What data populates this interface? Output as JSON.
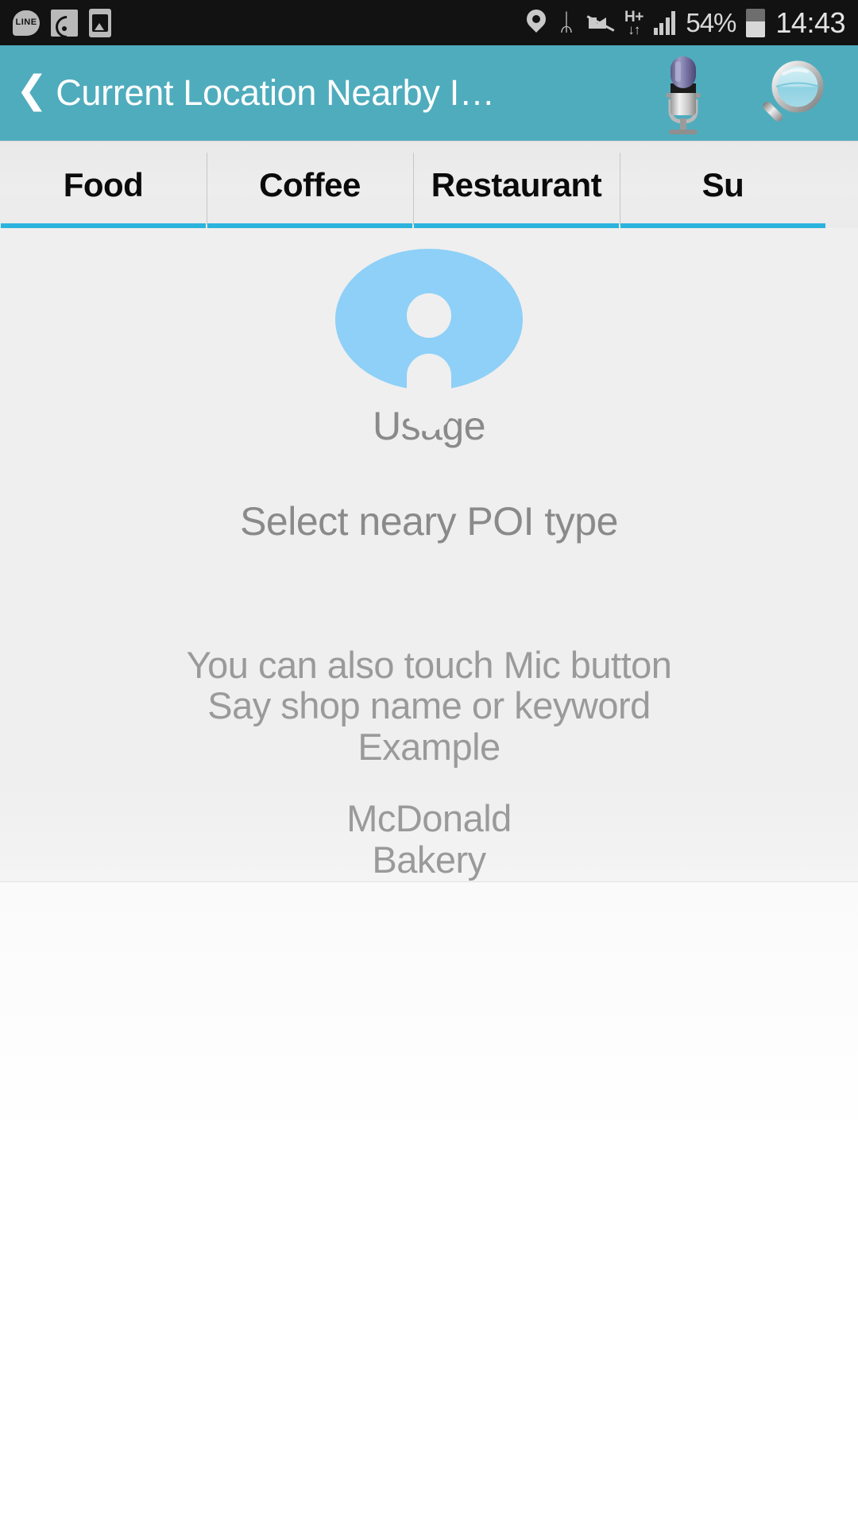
{
  "statusbar": {
    "left_icons": [
      {
        "name": "line-app-icon",
        "label": "LINE"
      },
      {
        "name": "wifi-icon",
        "label": ""
      },
      {
        "name": "gallery-icon",
        "label": ""
      }
    ],
    "right_icons": [
      {
        "name": "location-pin-icon",
        "label": ""
      },
      {
        "name": "bluetooth-icon",
        "label": "ᛦ"
      },
      {
        "name": "volume-mute-icon",
        "label": ""
      }
    ],
    "network_type": "H+",
    "network_arrows": "↓↑",
    "battery_percent": "54%",
    "battery_level": 54,
    "clock": "14:43"
  },
  "appbar": {
    "back_label": "❮",
    "title": "Current Location Nearby I…",
    "mic_icon": "microphone-icon",
    "search_icon": "magnifier-icon",
    "background_color": "#4FACBD"
  },
  "tabs": {
    "items": [
      {
        "label": "Food",
        "selected": true
      },
      {
        "label": "Coffee",
        "selected": true
      },
      {
        "label": "Restaurant",
        "selected": true
      },
      {
        "label": "Su",
        "selected": true
      }
    ],
    "indicator_color": "#2BB3DE"
  },
  "main": {
    "info_icon": "info-circle-icon",
    "info_icon_color": "#8ED0F7",
    "usage_heading": "Usage",
    "subtitle": "Select neary POI type",
    "hint_lines": [
      "You can also touch Mic button",
      "Say shop name or keyword",
      "Example"
    ],
    "example_lines": [
      "McDonald",
      "Bakery"
    ]
  }
}
